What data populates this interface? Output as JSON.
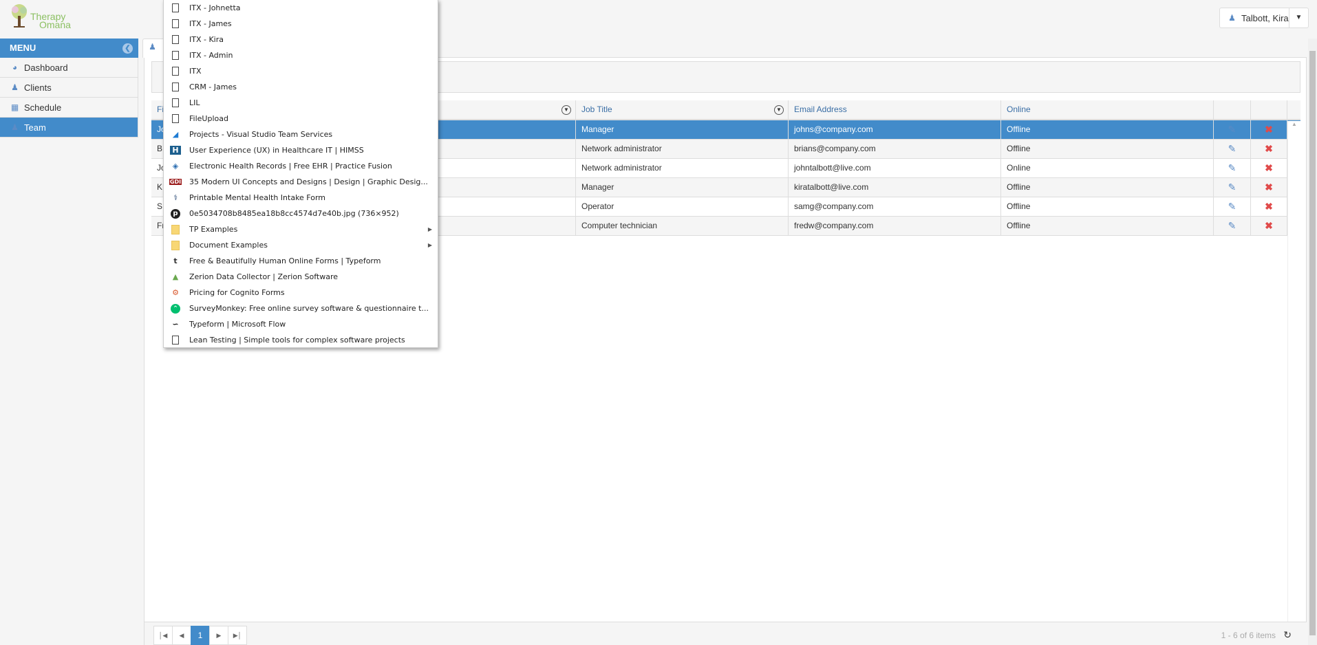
{
  "brand": {
    "line1": "Therapy",
    "line2": "Omana"
  },
  "user": {
    "name": "Talbott, Kira",
    "dropdown_icon": "caret-down-icon"
  },
  "sidebar": {
    "title": "MENU",
    "items": [
      {
        "label": "Dashboard",
        "icon": "dashboard-icon"
      },
      {
        "label": "Clients",
        "icon": "users-icon"
      },
      {
        "label": "Schedule",
        "icon": "calendar-icon"
      },
      {
        "label": "Team",
        "icon": "user-icon",
        "active": true
      }
    ]
  },
  "grid": {
    "columns": [
      "Fi",
      "Job Title",
      "Email Address",
      "Online"
    ],
    "rows": [
      {
        "name": "Jo",
        "job": "Manager",
        "email": "johns@company.com",
        "online": "Offline",
        "selected": true
      },
      {
        "name": "B",
        "job": "Network administrator",
        "email": "brians@company.com",
        "online": "Offline"
      },
      {
        "name": "Jo",
        "job": "Network administrator",
        "email": "johntalbott@live.com",
        "online": "Online"
      },
      {
        "name": "K",
        "job": "Manager",
        "email": "kiratalbott@live.com",
        "online": "Offline"
      },
      {
        "name": "S",
        "job": "Operator",
        "email": "samg@company.com",
        "online": "Offline"
      },
      {
        "name": "Fr",
        "job": "Computer technician",
        "email": "fredw@company.com",
        "online": "Offline"
      }
    ]
  },
  "pager": {
    "current_page": "1",
    "info": "1 - 6 of 6 items"
  },
  "context_menu": {
    "items": [
      {
        "label": "ITX - Johnetta",
        "icon": "page"
      },
      {
        "label": "ITX - James",
        "icon": "page"
      },
      {
        "label": "ITX - Kira",
        "icon": "page"
      },
      {
        "label": "ITX - Admin",
        "icon": "page"
      },
      {
        "label": "ITX",
        "icon": "page"
      },
      {
        "label": "CRM - James",
        "icon": "page"
      },
      {
        "label": "LIL",
        "icon": "page"
      },
      {
        "label": "FileUpload",
        "icon": "page"
      },
      {
        "label": "Projects - Visual Studio Team Services",
        "icon": "vsts"
      },
      {
        "label": "User Experience (UX) in Healthcare IT | HIMSS",
        "icon": "himss"
      },
      {
        "label": "Electronic Health Records | Free EHR | Practice Fusion",
        "icon": "practice-fusion"
      },
      {
        "label": "35 Modern UI Concepts and Designs | Design | Graphic Desig...",
        "icon": "gdi"
      },
      {
        "label": "Printable Mental Health Intake Form",
        "icon": "caduceus"
      },
      {
        "label": "0e5034708b8485ea18b8cc4574d7e40b.jpg (736×952)",
        "icon": "pinterest"
      },
      {
        "label": "TP Examples",
        "icon": "folder",
        "submenu": true
      },
      {
        "label": "Document Examples",
        "icon": "folder",
        "submenu": true
      },
      {
        "label": "Free & Beautifully Human Online Forms | Typeform",
        "icon": "typeform"
      },
      {
        "label": "Zerion Data Collector | Zerion Software",
        "icon": "zerion"
      },
      {
        "label": "Pricing for Cognito Forms",
        "icon": "cognito"
      },
      {
        "label": "SurveyMonkey: Free online survey software & questionnaire t...",
        "icon": "surveymonkey"
      },
      {
        "label": "Typeform | Microsoft Flow",
        "icon": "flow"
      },
      {
        "label": "Lean Testing | Simple tools for complex software projects",
        "icon": "page"
      }
    ]
  },
  "colors": {
    "accent": "#428bca",
    "delete": "#e04a4a",
    "brand_green": "#8cc063"
  }
}
